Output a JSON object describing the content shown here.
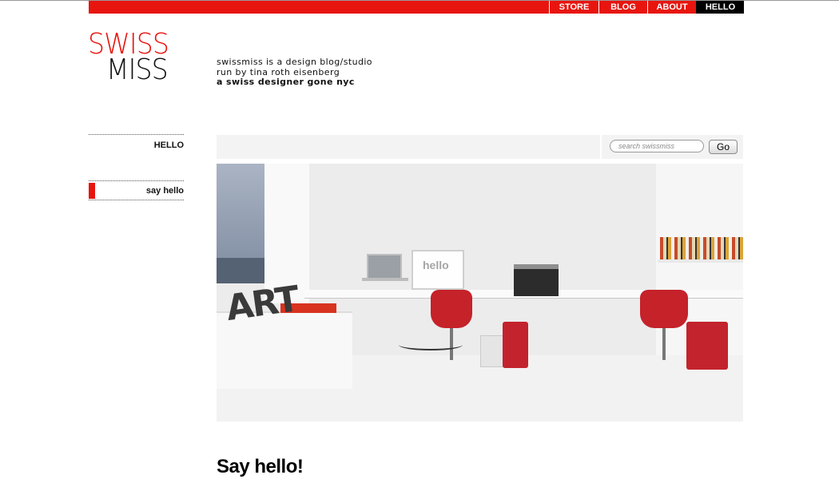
{
  "nav": {
    "items": [
      {
        "label": "STORE",
        "active": false
      },
      {
        "label": "BLOG",
        "active": false
      },
      {
        "label": "ABOUT",
        "active": false
      },
      {
        "label": "HELLO",
        "active": true
      }
    ],
    "bar_color": "#e8150f"
  },
  "logo": {
    "top": "SWISS",
    "bottom": "MISS",
    "top_color": "#e8150f",
    "bottom_color": "#111111"
  },
  "tagline": {
    "line1": "swissmiss is a design blog/studio",
    "line2": "run by tina roth eisenberg",
    "line3": "a swiss designer gone nyc"
  },
  "sidebar": {
    "section_title": "HELLO",
    "items": [
      {
        "label": "say hello",
        "active": true
      }
    ]
  },
  "search": {
    "placeholder": "search swissmiss",
    "value": "",
    "button_label": "Go"
  },
  "hero": {
    "screen_text": "hello",
    "letters_text": "ART"
  },
  "main": {
    "heading": "Say hello!"
  }
}
